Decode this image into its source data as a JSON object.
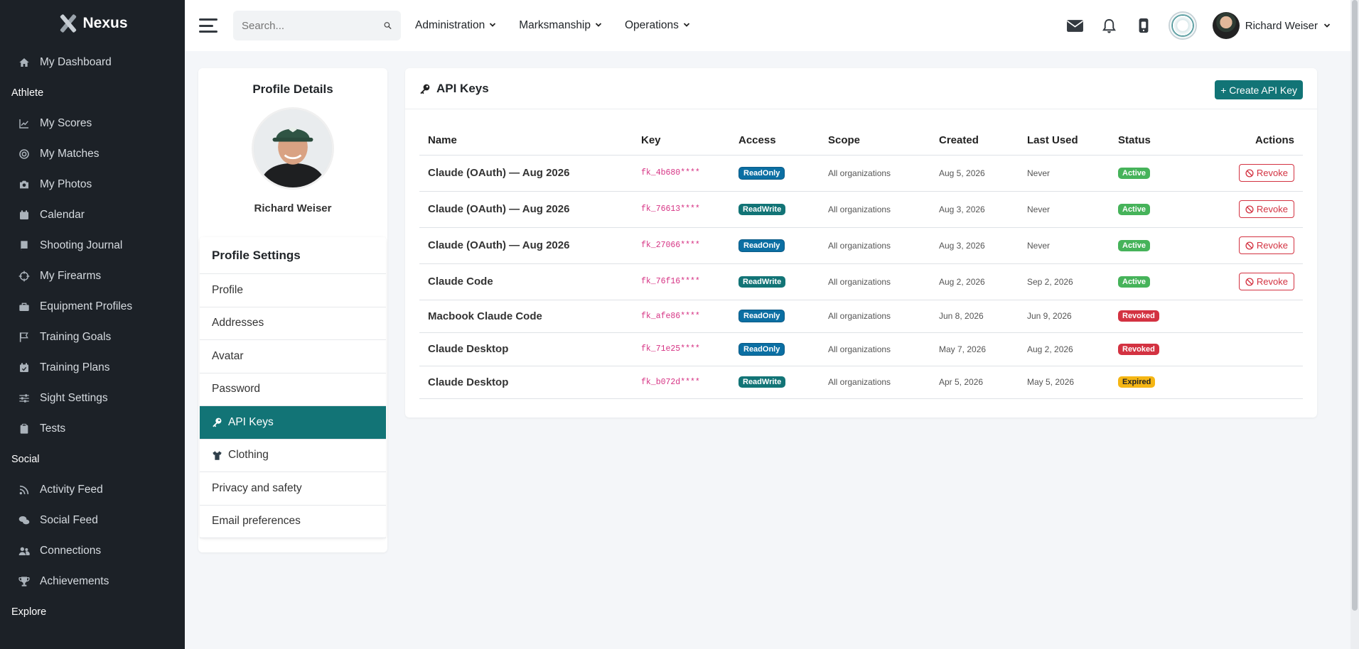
{
  "app": {
    "brand": "Nexus"
  },
  "sidebar": {
    "groups": [
      {
        "section": "",
        "items": [
          {
            "label": "My Dashboard",
            "icon": "home-icon"
          }
        ]
      },
      {
        "section": "Athlete",
        "items": [
          {
            "label": "My Scores",
            "icon": "chart-line-icon"
          },
          {
            "label": "My Matches",
            "icon": "target-icon"
          },
          {
            "label": "My Photos",
            "icon": "camera-icon"
          },
          {
            "label": "Calendar",
            "icon": "calendar-icon"
          },
          {
            "label": "Shooting Journal",
            "icon": "book-icon"
          },
          {
            "label": "My Firearms",
            "icon": "crosshair-icon"
          },
          {
            "label": "Equipment Profiles",
            "icon": "toolbox-icon"
          },
          {
            "label": "Training Goals",
            "icon": "flag-icon"
          },
          {
            "label": "Training Plans",
            "icon": "calendar-check-icon"
          },
          {
            "label": "Sight Settings",
            "icon": "sliders-icon"
          },
          {
            "label": "Tests",
            "icon": "clipboard-icon"
          }
        ]
      },
      {
        "section": "Social",
        "items": [
          {
            "label": "Activity Feed",
            "icon": "rss-icon"
          },
          {
            "label": "Social Feed",
            "icon": "comments-icon"
          },
          {
            "label": "Connections",
            "icon": "users-icon"
          },
          {
            "label": "Achievements",
            "icon": "trophy-icon"
          }
        ]
      },
      {
        "section": "Explore",
        "items": []
      }
    ]
  },
  "topbar": {
    "search_placeholder": "Search...",
    "menus": [
      "Administration",
      "Marksmanship",
      "Operations"
    ],
    "user_name": "Richard Weiser"
  },
  "profile": {
    "title": "Profile Details",
    "name": "Richard Weiser",
    "settings_title": "Profile Settings",
    "settings_items": [
      {
        "label": "Profile",
        "active": false,
        "icon": ""
      },
      {
        "label": "Addresses",
        "active": false,
        "icon": ""
      },
      {
        "label": "Avatar",
        "active": false,
        "icon": ""
      },
      {
        "label": "Password",
        "active": false,
        "icon": ""
      },
      {
        "label": "API Keys",
        "active": true,
        "icon": "key-icon"
      },
      {
        "label": "Clothing",
        "active": false,
        "icon": "shirt-icon"
      },
      {
        "label": "Privacy and safety",
        "active": false,
        "icon": ""
      },
      {
        "label": "Email preferences",
        "active": false,
        "icon": ""
      }
    ]
  },
  "api_keys": {
    "title": "API Keys",
    "create_label": "+ Create API Key",
    "revoke_label": "Revoke",
    "columns": [
      "Name",
      "Key",
      "Access",
      "Scope",
      "Created",
      "Last Used",
      "Status",
      "Actions"
    ],
    "rows": [
      {
        "name": "Claude (OAuth) — Aug 2026",
        "key": "fk_4b680****",
        "access": "ReadOnly",
        "scope": "All organizations",
        "created": "Aug 5, 2026",
        "last_used": "Never",
        "status": "Active",
        "can_revoke": true
      },
      {
        "name": "Claude (OAuth) — Aug 2026",
        "key": "fk_76613****",
        "access": "ReadWrite",
        "scope": "All organizations",
        "created": "Aug 3, 2026",
        "last_used": "Never",
        "status": "Active",
        "can_revoke": true
      },
      {
        "name": "Claude (OAuth) — Aug 2026",
        "key": "fk_27066****",
        "access": "ReadOnly",
        "scope": "All organizations",
        "created": "Aug 3, 2026",
        "last_used": "Never",
        "status": "Active",
        "can_revoke": true
      },
      {
        "name": "Claude Code",
        "key": "fk_76f16****",
        "access": "ReadWrite",
        "scope": "All organizations",
        "created": "Aug 2, 2026",
        "last_used": "Sep 2, 2026",
        "status": "Active",
        "can_revoke": true
      },
      {
        "name": "Macbook Claude Code",
        "key": "fk_afe86****",
        "access": "ReadOnly",
        "scope": "All organizations",
        "created": "Jun 8, 2026",
        "last_used": "Jun 9, 2026",
        "status": "Revoked",
        "can_revoke": false
      },
      {
        "name": "Claude Desktop",
        "key": "fk_71e25****",
        "access": "ReadOnly",
        "scope": "All organizations",
        "created": "May 7, 2026",
        "last_used": "Aug 2, 2026",
        "status": "Revoked",
        "can_revoke": false
      },
      {
        "name": "Claude Desktop",
        "key": "fk_b072d****",
        "access": "ReadWrite",
        "scope": "All organizations",
        "created": "Apr 5, 2026",
        "last_used": "May 5, 2026",
        "status": "Expired",
        "can_revoke": false
      }
    ]
  },
  "colors": {
    "accent": "#127476",
    "sidebar_bg": "#1c2127",
    "danger": "#d33241",
    "success": "#46b35a",
    "warning": "#f5b614",
    "info": "#0b6fa3"
  }
}
